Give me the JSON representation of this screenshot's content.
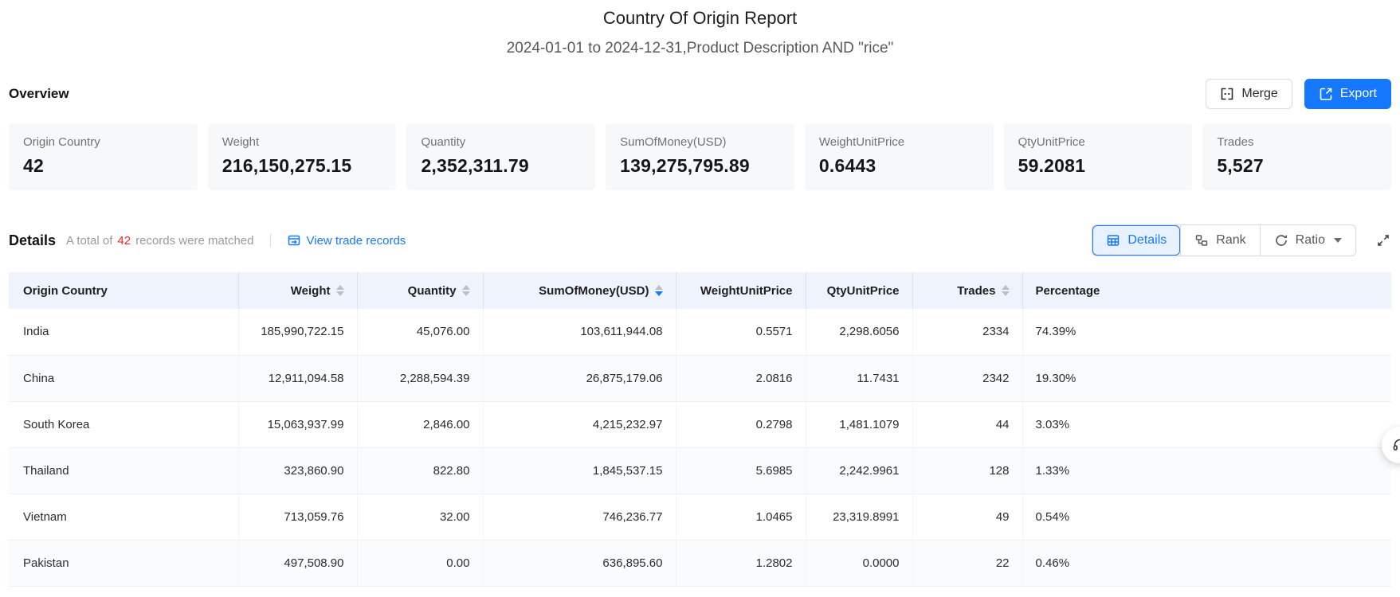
{
  "report": {
    "title": "Country Of Origin Report",
    "subtitle": "2024-01-01 to 2024-12-31,Product Description AND \"rice\""
  },
  "toolbar": {
    "overview_label": "Overview",
    "merge_label": "Merge",
    "export_label": "Export"
  },
  "overview_cards": [
    {
      "label": "Origin Country",
      "value": "42"
    },
    {
      "label": "Weight",
      "value": "216,150,275.15"
    },
    {
      "label": "Quantity",
      "value": "2,352,311.79"
    },
    {
      "label": "SumOfMoney(USD)",
      "value": "139,275,795.89"
    },
    {
      "label": "WeightUnitPrice",
      "value": "0.6443"
    },
    {
      "label": "QtyUnitPrice",
      "value": "59.2081"
    },
    {
      "label": "Trades",
      "value": "5,527"
    }
  ],
  "details": {
    "heading": "Details",
    "match_prefix": "A total of",
    "match_count": "42",
    "match_suffix": "records were matched",
    "view_trade_records_label": "View trade records",
    "view_modes": [
      {
        "label": "Details",
        "icon": "table-icon",
        "active": true,
        "has_caret": false
      },
      {
        "label": "Rank",
        "icon": "rank-icon",
        "active": false,
        "has_caret": false
      },
      {
        "label": "Ratio",
        "icon": "ratio-icon",
        "active": false,
        "has_caret": true
      }
    ]
  },
  "table": {
    "columns": [
      {
        "label": "Origin Country",
        "align": "left",
        "sortable": false,
        "sort": null
      },
      {
        "label": "Weight",
        "align": "right",
        "sortable": true,
        "sort": null
      },
      {
        "label": "Quantity",
        "align": "right",
        "sortable": true,
        "sort": null
      },
      {
        "label": "SumOfMoney(USD)",
        "align": "right",
        "sortable": true,
        "sort": "desc"
      },
      {
        "label": "WeightUnitPrice",
        "align": "right",
        "sortable": false,
        "sort": null
      },
      {
        "label": "QtyUnitPrice",
        "align": "right",
        "sortable": false,
        "sort": null
      },
      {
        "label": "Trades",
        "align": "right",
        "sortable": true,
        "sort": null
      },
      {
        "label": "Percentage",
        "align": "left",
        "sortable": false,
        "sort": null
      }
    ],
    "rows": [
      [
        "India",
        "185,990,722.15",
        "45,076.00",
        "103,611,944.08",
        "0.5571",
        "2,298.6056",
        "2334",
        "74.39%"
      ],
      [
        "China",
        "12,911,094.58",
        "2,288,594.39",
        "26,875,179.06",
        "2.0816",
        "11.7431",
        "2342",
        "19.30%"
      ],
      [
        "South Korea",
        "15,063,937.99",
        "2,846.00",
        "4,215,232.97",
        "0.2798",
        "1,481.1079",
        "44",
        "3.03%"
      ],
      [
        "Thailand",
        "323,860.90",
        "822.80",
        "1,845,537.15",
        "5.6985",
        "2,242.9961",
        "128",
        "1.33%"
      ],
      [
        "Vietnam",
        "713,059.76",
        "32.00",
        "746,236.77",
        "1.0465",
        "23,319.8991",
        "49",
        "0.54%"
      ],
      [
        "Pakistan",
        "497,508.90",
        "0.00",
        "636,895.60",
        "1.2802",
        "0.0000",
        "22",
        "0.46%"
      ]
    ]
  },
  "colors": {
    "accent": "#1677ff",
    "count_red": "#f5222d",
    "header_bg": "#eef3fc",
    "card_bg": "#f7f8fa"
  },
  "icons": {
    "merge": "merge-cells-icon",
    "export": "export-icon",
    "view_records": "trade-records-icon",
    "fullscreen": "fullscreen-expand-icon",
    "support": "headset-icon"
  }
}
